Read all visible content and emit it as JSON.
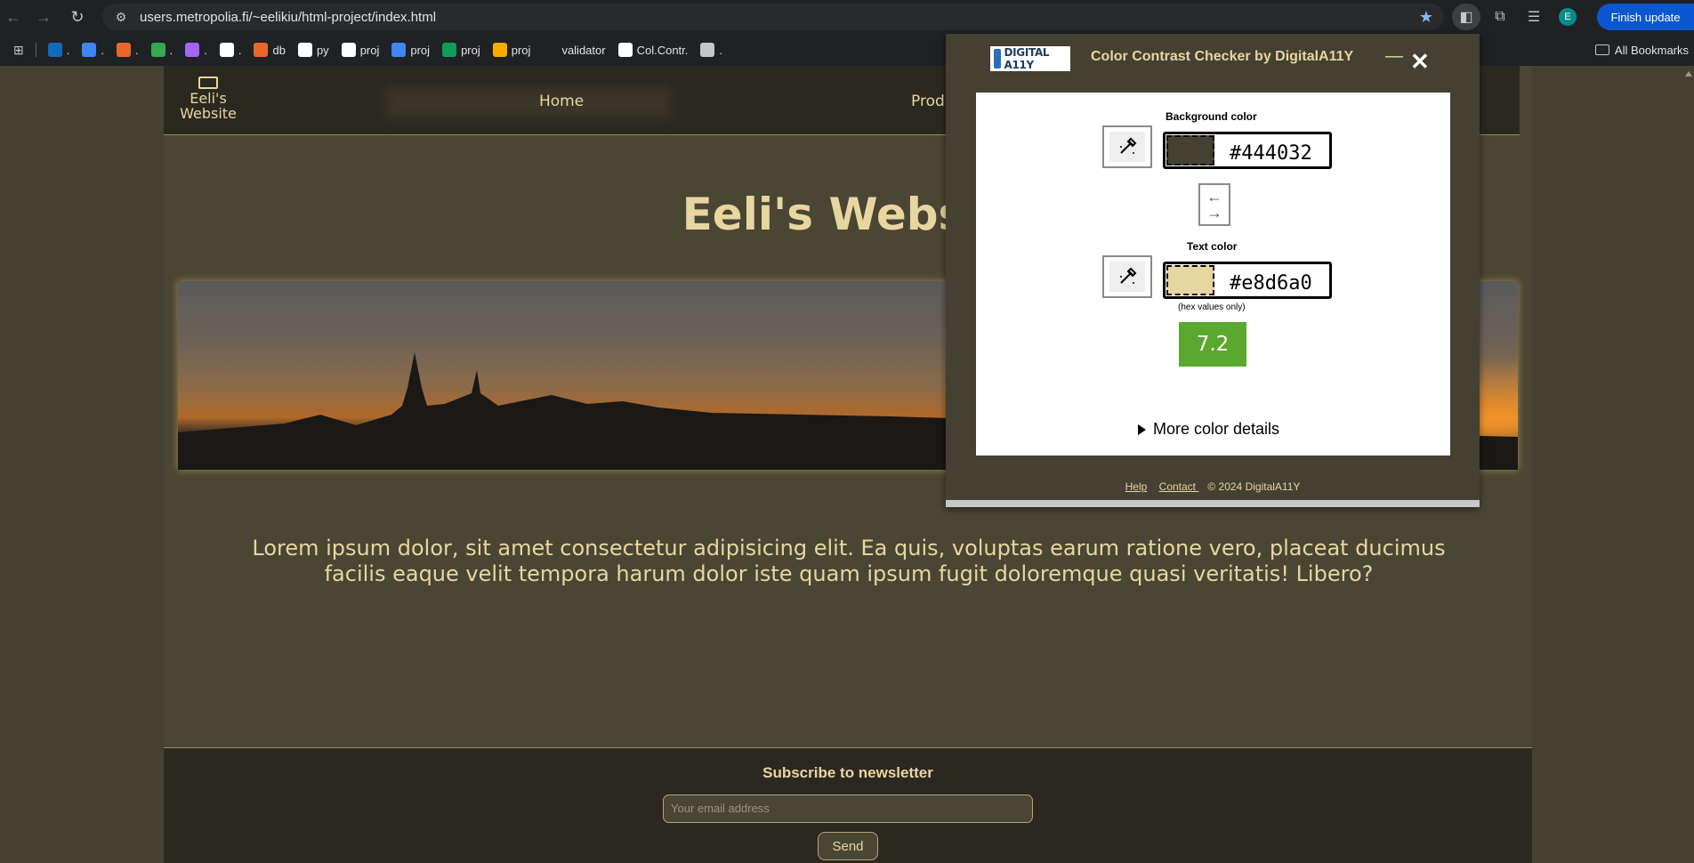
{
  "browser": {
    "url": "users.metropolia.fi/~eelikiu/html-project/index.html",
    "finish_update": "Finish update",
    "avatar_letter": "E",
    "all_bookmarks": "All Bookmarks",
    "bookmarks": [
      {
        "label": ".",
        "icon": "outlook-icon",
        "color": "#0f6cbd"
      },
      {
        "label": ".",
        "icon": "translate-icon",
        "color": "#4285f4"
      },
      {
        "label": ".",
        "icon": "metropolia-icon",
        "color": "#e8682a"
      },
      {
        "label": ".",
        "icon": "drive-icon",
        "color": "#34a853"
      },
      {
        "label": ".",
        "icon": "copilot-icon",
        "color": "#a266f0"
      },
      {
        "label": ".",
        "icon": "github-icon",
        "color": "#ffffff"
      },
      {
        "label": "db",
        "icon": "metropolia-icon",
        "color": "#e8682a"
      },
      {
        "label": "py",
        "icon": "github-icon",
        "color": "#ffffff"
      },
      {
        "label": "proj",
        "icon": "github-icon",
        "color": "#ffffff"
      },
      {
        "label": "proj",
        "icon": "docs-icon",
        "color": "#4285f4"
      },
      {
        "label": "proj",
        "icon": "sheets-icon",
        "color": "#0f9d58"
      },
      {
        "label": "proj",
        "icon": "colab-icon",
        "color": "#f9ab00"
      },
      {
        "label": "validator",
        "icon": "nu-icon",
        "color": "#202124"
      },
      {
        "label": "Col.Contr.",
        "icon": "lifebuoy-icon",
        "color": "#ffffff"
      },
      {
        "label": ".",
        "icon": "extension-icon",
        "color": "#c4c7c5"
      }
    ]
  },
  "site": {
    "logo_line1": "Eeli's",
    "logo_line2": "Website",
    "nav_home": "Home",
    "nav_products": "Prod",
    "hero_title": "Eeli's Websit",
    "lorem": "Lorem ipsum dolor, sit amet consectetur adipisicing elit. Ea quis, voluptas earum ratione vero, placeat ducimus facilis eaque velit tempora harum dolor iste quam ipsum fugit doloremque quasi veritatis! Libero?",
    "subscribe_title": "Subscribe to newsletter",
    "email_placeholder": "Your email address",
    "send_label": "Send"
  },
  "checker": {
    "brand": "DIGITAL A11Y",
    "title": "Color Contrast Checker by DigitalA11Y",
    "bg_label": "Background color",
    "bg_hex": "#444032",
    "text_label": "Text color",
    "text_hex": "#e8d6a0",
    "hex_hint": "(hex values only)",
    "ratio": "7.2",
    "ratio_color": "#5aa82d",
    "more_details": "More color details",
    "help": "Help",
    "contact": "Contact ",
    "copyright": "© 2024 DigitalA11Y"
  }
}
